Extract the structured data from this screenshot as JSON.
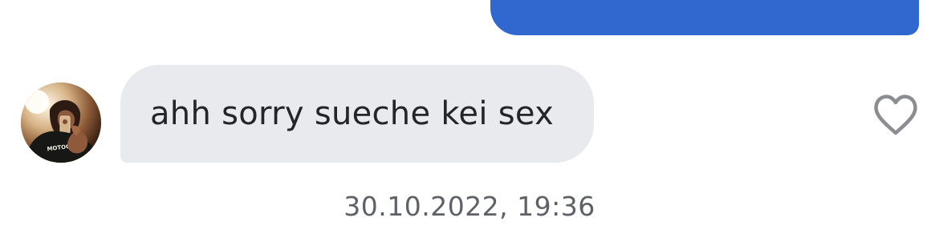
{
  "conversation": {
    "incoming_message": {
      "text": "ahh sorry sueche kei sex",
      "avatar_icon": "user-avatar-photo"
    },
    "outgoing_message": {
      "color": "#3068d0"
    },
    "timestamp": "30.10.2022, 19:36",
    "like_icon": "heart-outline-icon",
    "colors": {
      "incoming_bubble": "#e9eaee",
      "text": "#252528",
      "timestamp": "#5f6168",
      "heart": "#8b8d92"
    }
  }
}
